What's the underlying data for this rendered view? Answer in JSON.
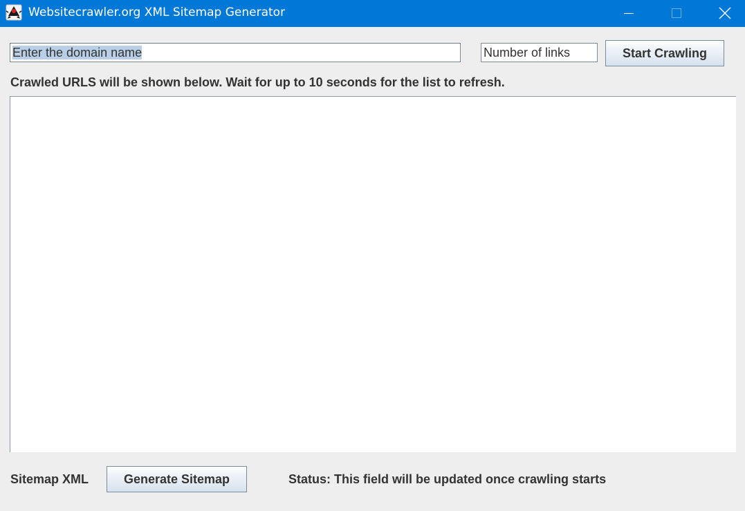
{
  "window": {
    "title": "Websitecrawler.org XML Sitemap Generator",
    "app_icon": "java-duke-icon",
    "controls": [
      "minimize-icon",
      "maximize-icon",
      "close-icon"
    ],
    "titlebar_color": "#0078d7"
  },
  "domain_field": {
    "value": "Enter the domain name"
  },
  "links_field": {
    "value": "Number of links"
  },
  "buttons": {
    "start_crawling": "Start Crawling",
    "generate_sitemap": "Generate Sitemap"
  },
  "instructions": "Crawled URLS will be shown below. Wait for up to 10 seconds for the list to refresh.",
  "url_list": {
    "items": []
  },
  "footer": {
    "sitemap_label": "Sitemap XML",
    "status_text": "Status: This field will be updated once crawling starts"
  }
}
